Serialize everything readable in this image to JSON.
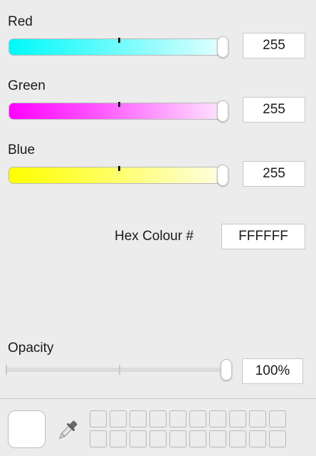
{
  "sliders": [
    {
      "label": "Red",
      "value": "255",
      "level": 1.0
    },
    {
      "label": "Green",
      "value": "255",
      "level": 1.0
    },
    {
      "label": "Blue",
      "value": "255",
      "level": 1.0
    }
  ],
  "hex": {
    "label": "Hex Colour #",
    "value": "FFFFFF"
  },
  "opacity": {
    "label": "Opacity",
    "value": "100%",
    "level": 1.0
  },
  "current_color": "#FFFFFF",
  "icons": {
    "picker": "eyedropper-icon"
  },
  "swatch_count": 20
}
